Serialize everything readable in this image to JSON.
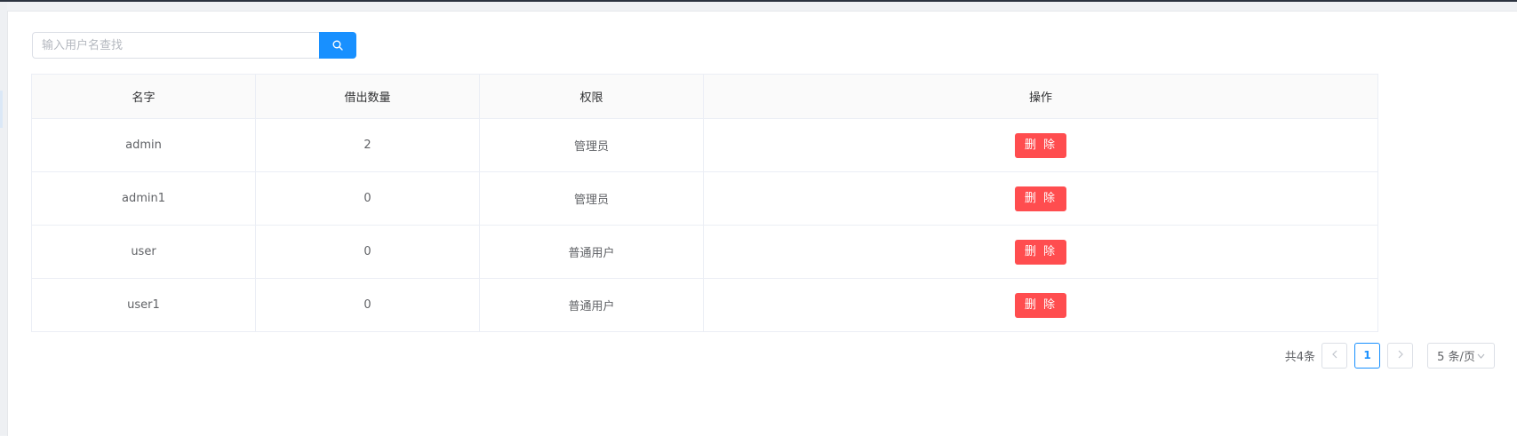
{
  "search": {
    "placeholder": "输入用户名查找",
    "button_icon": "search-icon"
  },
  "table": {
    "headers": [
      "名字",
      "借出数量",
      "权限",
      "操作"
    ],
    "rows": [
      {
        "name": "admin",
        "borrowed": "2",
        "role": "管理员",
        "action": "删 除"
      },
      {
        "name": "admin1",
        "borrowed": "0",
        "role": "管理员",
        "action": "删 除"
      },
      {
        "name": "user",
        "borrowed": "0",
        "role": "普通用户",
        "action": "删 除"
      },
      {
        "name": "user1",
        "borrowed": "0",
        "role": "普通用户",
        "action": "删 除"
      }
    ]
  },
  "pagination": {
    "total": "共4条",
    "current_page": "1",
    "page_size": "5 条/页",
    "prev_icon": "chevron-left-icon",
    "next_icon": "chevron-right-icon"
  },
  "colors": {
    "primary": "#1890ff",
    "danger": "#ff4d4f"
  }
}
